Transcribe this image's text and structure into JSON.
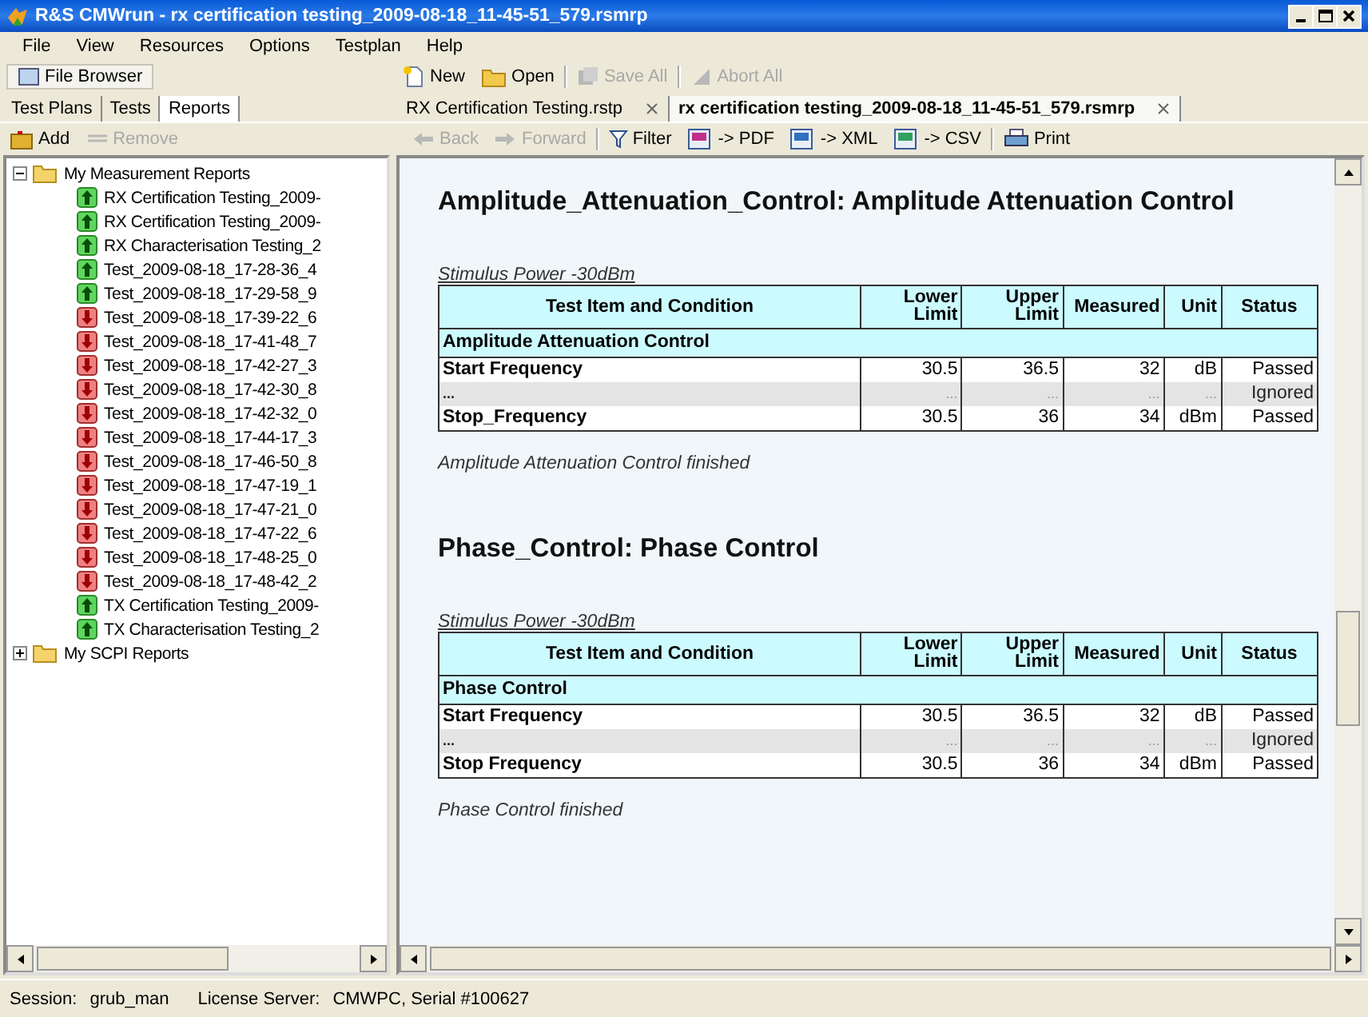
{
  "window": {
    "title": "R&S CMWrun - rx certification testing_2009-08-18_11-45-51_579.rsmrp"
  },
  "menu": [
    "File",
    "View",
    "Resources",
    "Options",
    "Testplan",
    "Help"
  ],
  "file_browser": {
    "label": "File Browser"
  },
  "toolbar": [
    {
      "label": "New",
      "kind": "new",
      "disabled": false
    },
    {
      "label": "Open",
      "kind": "open",
      "disabled": false
    },
    {
      "label": "Save All",
      "kind": "save",
      "disabled": true
    },
    {
      "label": "Abort All",
      "kind": "abort",
      "disabled": true
    }
  ],
  "side_tabs": [
    {
      "label": "Test Plans",
      "selected": false
    },
    {
      "label": "Tests",
      "selected": false
    },
    {
      "label": "Reports",
      "selected": true
    }
  ],
  "doc_tabs": [
    {
      "label": "RX Certification Testing.rstp",
      "selected": false
    },
    {
      "label": "rx certification testing_2009-08-18_11-45-51_579.rsmrp",
      "selected": true
    }
  ],
  "side_actions": [
    {
      "label": "Add",
      "kind": "add",
      "disabled": false
    },
    {
      "label": "Remove",
      "kind": "remove",
      "disabled": true
    }
  ],
  "report_toolbar": [
    {
      "label": "Back",
      "kind": "back",
      "disabled": true
    },
    {
      "label": "Forward",
      "kind": "forward",
      "disabled": true
    },
    {
      "label": "Filter",
      "kind": "filter",
      "disabled": false
    },
    {
      "label": "-> PDF",
      "kind": "pdf",
      "disabled": false
    },
    {
      "label": "-> XML",
      "kind": "xml",
      "disabled": false
    },
    {
      "label": "-> CSV",
      "kind": "csv",
      "disabled": false
    },
    {
      "label": "Print",
      "kind": "print",
      "disabled": false
    }
  ],
  "tree": [
    {
      "label": "My Measurement Reports",
      "expanded": true,
      "children": [
        {
          "label": "RX Certification Testing_2009-",
          "kind": "pass"
        },
        {
          "label": "RX Certification Testing_2009-",
          "kind": "pass"
        },
        {
          "label": "RX Characterisation Testing_2",
          "kind": "pass"
        },
        {
          "label": "Test_2009-08-18_17-28-36_4",
          "kind": "pass"
        },
        {
          "label": "Test_2009-08-18_17-29-58_9",
          "kind": "pass"
        },
        {
          "label": "Test_2009-08-18_17-39-22_6",
          "kind": "fail"
        },
        {
          "label": "Test_2009-08-18_17-41-48_7",
          "kind": "fail"
        },
        {
          "label": "Test_2009-08-18_17-42-27_3",
          "kind": "fail"
        },
        {
          "label": "Test_2009-08-18_17-42-30_8",
          "kind": "fail"
        },
        {
          "label": "Test_2009-08-18_17-42-32_0",
          "kind": "fail"
        },
        {
          "label": "Test_2009-08-18_17-44-17_3",
          "kind": "fail"
        },
        {
          "label": "Test_2009-08-18_17-46-50_8",
          "kind": "fail"
        },
        {
          "label": "Test_2009-08-18_17-47-19_1",
          "kind": "fail"
        },
        {
          "label": "Test_2009-08-18_17-47-21_0",
          "kind": "fail"
        },
        {
          "label": "Test_2009-08-18_17-47-22_6",
          "kind": "fail"
        },
        {
          "label": "Test_2009-08-18_17-48-25_0",
          "kind": "fail"
        },
        {
          "label": "Test_2009-08-18_17-48-42_2",
          "kind": "fail"
        },
        {
          "label": "TX Certification Testing_2009-",
          "kind": "pass"
        },
        {
          "label": "TX Characterisation Testing_2",
          "kind": "pass"
        }
      ]
    },
    {
      "label": "My SCPI Reports",
      "expanded": false
    }
  ],
  "report": {
    "sections": [
      {
        "title": "Amplitude_Attenuation_Control: Amplitude Attenuation Control",
        "stimulus": "Stimulus Power -30dBm",
        "columns": [
          "Test Item and Condition",
          "Lower Limit",
          "Upper Limit",
          "Measured",
          "Unit",
          "Status"
        ],
        "group": "Amplitude Attenuation Control",
        "rows": [
          {
            "kind": "result",
            "cells": [
              "Start Frequency",
              "30.5",
              "36.5",
              "32",
              "dB",
              "Passed"
            ]
          },
          {
            "kind": "ignored",
            "cells": [
              "...",
              "...",
              "...",
              "...",
              "...",
              "Ignored"
            ]
          },
          {
            "kind": "result",
            "cells": [
              "Stop_Frequency",
              "30.5",
              "36",
              "34",
              "dBm",
              "Passed"
            ]
          }
        ],
        "footer": "Amplitude Attenuation Control finished"
      },
      {
        "title": "Phase_Control: Phase Control",
        "stimulus": "Stimulus Power -30dBm",
        "columns": [
          "Test Item and Condition",
          "Lower Limit",
          "Upper Limit",
          "Measured",
          "Unit",
          "Status"
        ],
        "group": "Phase Control",
        "rows": [
          {
            "kind": "result",
            "cells": [
              "Start Frequency",
              "30.5",
              "36.5",
              "32",
              "dB",
              "Passed"
            ]
          },
          {
            "kind": "ignored",
            "cells": [
              "...",
              "...",
              "...",
              "...",
              "...",
              "Ignored"
            ]
          },
          {
            "kind": "result",
            "cells": [
              "Stop Frequency",
              "30.5",
              "36",
              "34",
              "dBm",
              "Passed"
            ]
          }
        ],
        "footer": "Phase Control finished"
      }
    ]
  },
  "status_bar": [
    {
      "label": "Session:",
      "value": "grub_man"
    },
    {
      "label": "License Server:",
      "value": "CMWPC, Serial #100627"
    }
  ]
}
